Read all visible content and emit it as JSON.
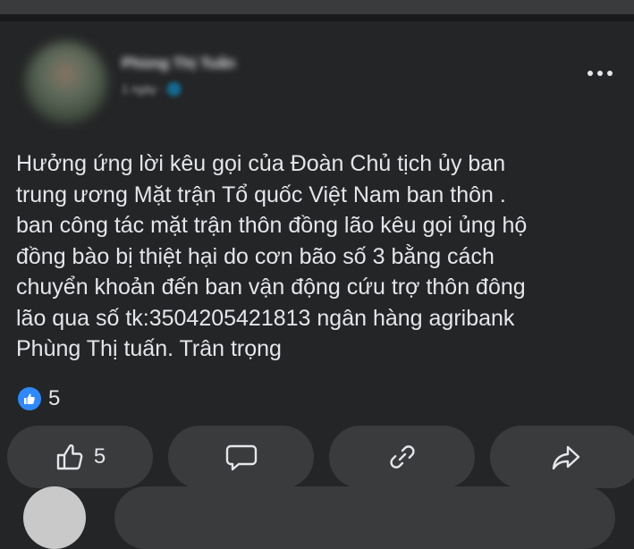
{
  "post": {
    "author_name": "Phùng Thị Tuấn",
    "author_meta": "1 ngày · 🌐",
    "text": "Hưởng ứng lời kêu gọi của Đoàn Chủ tịch ủy ban\ntrung ương Mặt trận Tổ quốc Việt Nam  ban thôn .\nban công tác mặt trận thôn đồng lão kêu gọi ủng hộ\nđồng bào bị thiệt hại do cơn bão số 3 bằng cách\nchuyển khoản đến ban vận động cứu trợ thôn đông\nlão qua số tk:3504205421813 ngân hàng agribank\nPhùng Thị tuấn. Trân trọng",
    "reaction_count": "5"
  },
  "actions": {
    "like_count": "5"
  },
  "colors": {
    "background": "#242526",
    "button": "#3a3b3c",
    "text": "#e4e6eb",
    "like_blue": "#2e89ff"
  },
  "icons": [
    "more-icon",
    "like-reaction-icon",
    "thumbs-up-icon",
    "comment-icon",
    "link-icon",
    "share-icon"
  ]
}
